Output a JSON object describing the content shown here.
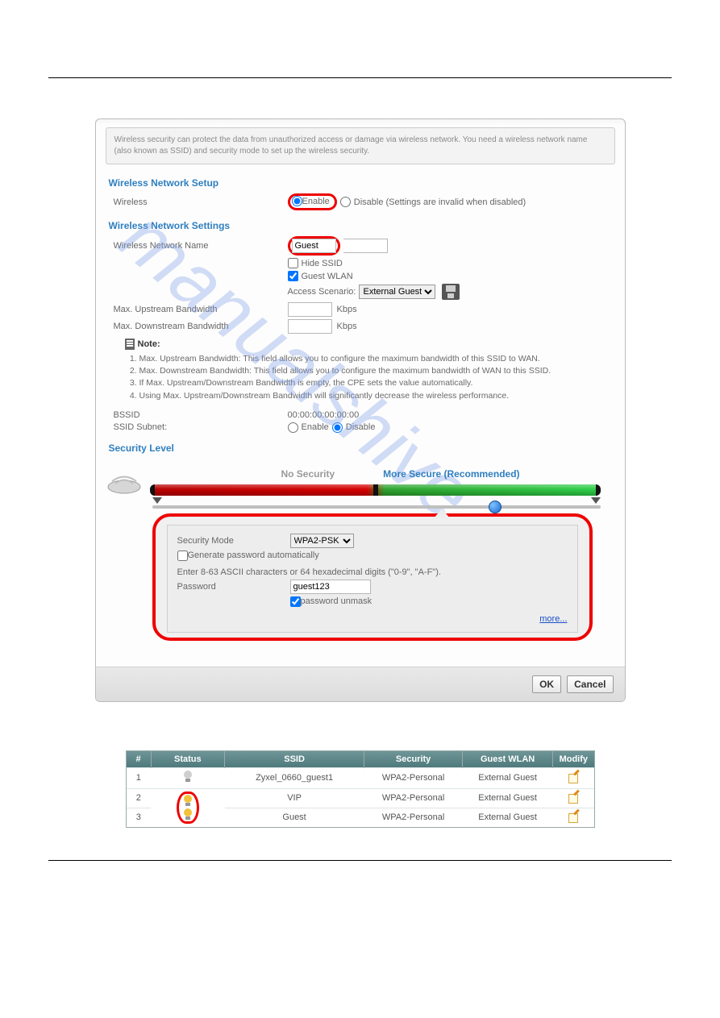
{
  "intro": "Wireless security can protect the data from unauthorized access or damage via wireless network. You need a wireless network name (also known as SSID) and security mode to set up the wireless security.",
  "sections": {
    "setup_title": "Wireless Network Setup",
    "settings_title": "Wireless Network Settings",
    "security_title": "Security Level"
  },
  "setup": {
    "label": "Wireless",
    "enable": "Enable",
    "disable": "Disable (Settings are invalid when disabled)",
    "enable_checked": true
  },
  "settings": {
    "name_label": "Wireless Network Name",
    "name_value": "Guest",
    "hide_ssid": "Hide SSID",
    "hide_ssid_checked": false,
    "guest_wlan": "Guest WLAN",
    "guest_wlan_checked": true,
    "scenario_label": "Access Scenario:",
    "scenario_value": "External Guest",
    "up_label": "Max. Upstream Bandwidth",
    "down_label": "Max. Downstream Bandwidth",
    "unit": "Kbps"
  },
  "note": {
    "heading": "Note:",
    "items": [
      "Max. Upstream Bandwidth: This field allows you to configure the maximum bandwidth of this SSID to WAN.",
      "Max. Downstream Bandwidth: This field allows you to configure the maximum bandwidth of WAN to this SSID.",
      "If Max. Upstream/Downstream Bandwidth is empty, the CPE sets the value automatically.",
      "Using Max. Upstream/Downstream Bandwidth will significantly decrease the wireless performance."
    ]
  },
  "bssid": {
    "label": "BSSID",
    "value": "00:00:00:00:00:00"
  },
  "ssid_subnet": {
    "label": "SSID Subnet:",
    "enable": "Enable",
    "disable": "Disable",
    "disable_checked": true
  },
  "security": {
    "no_label": "No Security",
    "more_label": "More Secure (Recommended)",
    "mode_label": "Security Mode",
    "mode_value": "WPA2-PSK",
    "gen_auto": "Generate password automatically",
    "hint": "Enter 8-63 ASCII characters or 64 hexadecimal digits (\"0-9\", \"A-F\").",
    "pwd_label": "Password",
    "pwd_value": "guest123",
    "unmask": "password unmask",
    "unmask_checked": true,
    "more_link": "more..."
  },
  "buttons": {
    "ok": "OK",
    "cancel": "Cancel"
  },
  "table": {
    "headers": [
      "#",
      "Status",
      "SSID",
      "Security",
      "Guest WLAN",
      "Modify"
    ],
    "rows": [
      {
        "n": "1",
        "on": false,
        "ssid": "Zyxel_0660_guest1",
        "sec": "WPA2-Personal",
        "guest": "External Guest"
      },
      {
        "n": "2",
        "on": true,
        "ssid": "VIP",
        "sec": "WPA2-Personal",
        "guest": "External Guest"
      },
      {
        "n": "3",
        "on": true,
        "ssid": "Guest",
        "sec": "WPA2-Personal",
        "guest": "External Guest"
      }
    ]
  },
  "watermark": "manualshive.com"
}
